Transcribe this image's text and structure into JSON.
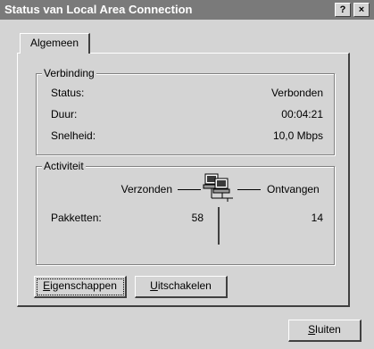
{
  "window": {
    "title": "Status van Local Area Connection",
    "help_label": "?",
    "close_label": "×"
  },
  "tabs": [
    {
      "label": "Algemeen",
      "selected": true
    }
  ],
  "connection": {
    "legend": "Verbinding",
    "status_label": "Status:",
    "status_value": "Verbonden",
    "duration_label": "Duur:",
    "duration_value": "00:04:21",
    "speed_label": "Snelheid:",
    "speed_value": "10,0 Mbps"
  },
  "activity": {
    "legend": "Activiteit",
    "sent_label": "Verzonden",
    "received_label": "Ontvangen",
    "packets_label": "Pakketten:",
    "packets_sent": "58",
    "packets_received": "14",
    "icon": "network-computers-icon"
  },
  "buttons": {
    "properties_first": "E",
    "properties_rest": "igenschappen",
    "disable_first": "U",
    "disable_rest": "itschakelen",
    "close_first": "S",
    "close_rest": "luiten"
  }
}
